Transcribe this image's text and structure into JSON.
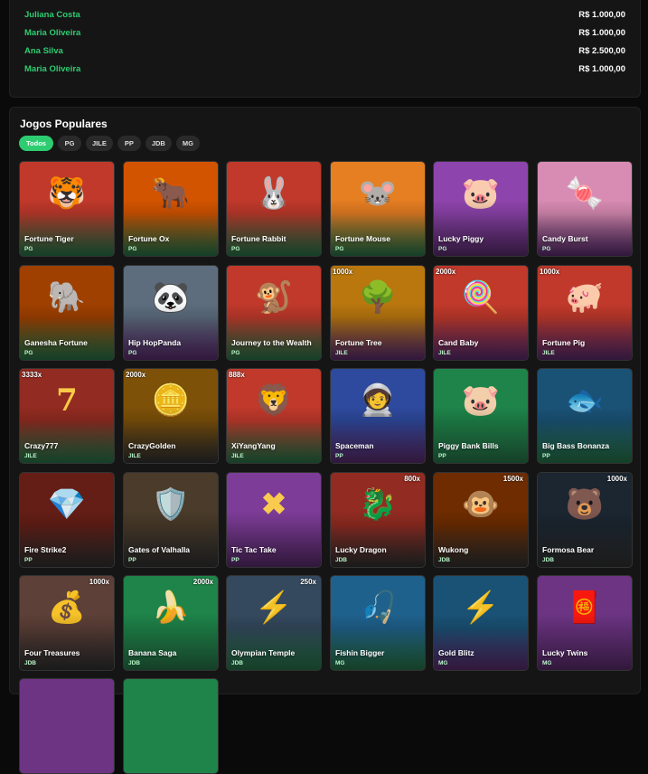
{
  "winners": [
    {
      "name": "Juliana Costa",
      "amount": "R$ 1.000,00"
    },
    {
      "name": "Maria Oliveira",
      "amount": "R$ 1.000,00"
    },
    {
      "name": "Ana Silva",
      "amount": "R$ 2.500,00"
    },
    {
      "name": "Maria Oliveira",
      "amount": "R$ 1.000,00"
    }
  ],
  "section": {
    "title": "Jogos Populares"
  },
  "filters": [
    "Todos",
    "PG",
    "JILE",
    "PP",
    "JDB",
    "MG"
  ],
  "games": [
    {
      "name": "Fortune Tiger",
      "provider": "PG",
      "icon": "tiger-icon",
      "glyph": "🐯",
      "bg": "#c0392b",
      "bg2": "#2e8b57"
    },
    {
      "name": "Fortune Ox",
      "provider": "PG",
      "icon": "ox-icon",
      "glyph": "🐂",
      "bg": "#d35400",
      "bg2": "#2e8b57"
    },
    {
      "name": "Fortune Rabbit",
      "provider": "PG",
      "icon": "rabbit-icon",
      "glyph": "🐰",
      "bg": "#c0392b",
      "bg2": "#2e8b57"
    },
    {
      "name": "Fortune Mouse",
      "provider": "PG",
      "icon": "mouse-icon",
      "glyph": "🐭",
      "bg": "#e67e22",
      "bg2": "#2e8b57"
    },
    {
      "name": "Lucky Piggy",
      "provider": "PG",
      "icon": "pig-icon",
      "glyph": "🐷",
      "bg": "#8e44ad",
      "bg2": "#6c3483"
    },
    {
      "name": "Candy Burst",
      "provider": "PG",
      "icon": "candy-icon",
      "glyph": "🍬",
      "bg": "#d98cb3",
      "bg2": "#6c3483"
    },
    {
      "name": "Ganesha Fortune",
      "provider": "PG",
      "icon": "elephant-icon",
      "glyph": "🐘",
      "bg": "#a04000",
      "bg2": "#2e8b57"
    },
    {
      "name": "Hip HopPanda",
      "provider": "PG",
      "icon": "panda-icon",
      "glyph": "🐼",
      "bg": "#5d6d7e",
      "bg2": "#6c3483"
    },
    {
      "name": "Journey to the Wealth",
      "provider": "PG",
      "icon": "monkey-icon",
      "glyph": "🐒",
      "bg": "#c0392b",
      "bg2": "#2e8b57"
    },
    {
      "name": "Fortune Tree",
      "provider": "JILE",
      "icon": "tree-icon",
      "glyph": "🌳",
      "bg": "#b9770e",
      "bg2": "#6c3483",
      "badge": "1000x"
    },
    {
      "name": "Cand Baby",
      "provider": "JILE",
      "icon": "candy-icon",
      "glyph": "🍭",
      "bg": "#c0392b",
      "bg2": "#6c3483",
      "badge": "2000x"
    },
    {
      "name": "Fortune Pig",
      "provider": "JILE",
      "icon": "pig-icon",
      "glyph": "🐖",
      "bg": "#c0392b",
      "bg2": "#6c3483",
      "badge": "1000x"
    },
    {
      "name": "Crazy777",
      "provider": "JILE",
      "icon": "seven-icon",
      "glyph": "7",
      "bg": "#922b21",
      "bg2": "#2e8b57",
      "badge": "3333x"
    },
    {
      "name": "CrazyGolden",
      "provider": "JILE",
      "icon": "coin-icon",
      "glyph": "🪙",
      "bg": "#7e5109",
      "bg2": "#3a3a3a",
      "badge": "2000x"
    },
    {
      "name": "XiYangYang",
      "provider": "JILE",
      "icon": "lion-icon",
      "glyph": "🦁",
      "bg": "#c0392b",
      "bg2": "#2e8b57",
      "badge": "888x"
    },
    {
      "name": "Spaceman",
      "provider": "PP",
      "icon": "astronaut-icon",
      "glyph": "🧑‍🚀",
      "bg": "#2e4a9e",
      "bg2": "#6c3483"
    },
    {
      "name": "Piggy Bank Bills",
      "provider": "PP",
      "icon": "pig-icon",
      "glyph": "🐷",
      "bg": "#1e8449",
      "bg2": "#2e8b57"
    },
    {
      "name": "Big Bass Bonanza",
      "provider": "PP",
      "icon": "fish-icon",
      "glyph": "🐟",
      "bg": "#1a5276",
      "bg2": "#2e8b57"
    },
    {
      "name": "Fire Strike2",
      "provider": "PP",
      "icon": "diamond-icon",
      "glyph": "💎",
      "bg": "#641e16",
      "bg2": "#3a3a3a"
    },
    {
      "name": "Gates of Valhalla",
      "provider": "PP",
      "icon": "gate-icon",
      "glyph": "🛡️",
      "bg": "#4a3b2a",
      "bg2": "#3a3a3a"
    },
    {
      "name": "Tic Tac Take",
      "provider": "PP",
      "icon": "tictactoe-icon",
      "glyph": "✖",
      "bg": "#7d3c98",
      "bg2": "#6c3483"
    },
    {
      "name": "Lucky Dragon",
      "provider": "JDB",
      "icon": "dragon-icon",
      "glyph": "🐉",
      "bg": "#922b21",
      "bg2": "#3a3a3a",
      "badge": "800x"
    },
    {
      "name": "Wukong",
      "provider": "JDB",
      "icon": "monkey-icon",
      "glyph": "🐵",
      "bg": "#6e2c00",
      "bg2": "#3a3a3a",
      "badge": "1500x"
    },
    {
      "name": "Formosa Bear",
      "provider": "JDB",
      "icon": "bear-icon",
      "glyph": "🐻",
      "bg": "#1b2631",
      "bg2": "#3a3a3a",
      "badge": "1000x"
    },
    {
      "name": "Four Treasures",
      "provider": "JDB",
      "icon": "treasure-icon",
      "glyph": "💰",
      "bg": "#5d4037",
      "bg2": "#3a3a3a",
      "badge": "1000x"
    },
    {
      "name": "Banana Saga",
      "provider": "JDB",
      "icon": "banana-icon",
      "glyph": "🍌",
      "bg": "#1e8449",
      "bg2": "#2e8b57",
      "badge": "2000x"
    },
    {
      "name": "Olympian Temple",
      "provider": "JDB",
      "icon": "zeus-icon",
      "glyph": "⚡",
      "bg": "#34495e",
      "bg2": "#2e8b57",
      "badge": "250x"
    },
    {
      "name": "Fishin Bigger",
      "provider": "MG",
      "icon": "fish-icon",
      "glyph": "🎣",
      "bg": "#1f618d",
      "bg2": "#2e8b57"
    },
    {
      "name": "Gold Blitz",
      "provider": "MG",
      "icon": "lightning-icon",
      "glyph": "⚡",
      "bg": "#1a5276",
      "bg2": "#6c3483"
    },
    {
      "name": "Lucky Twins",
      "provider": "MG",
      "icon": "twins-icon",
      "glyph": "🧧",
      "bg": "#6c3483",
      "bg2": "#6c3483"
    }
  ],
  "partial_row": {
    "count": 2
  }
}
